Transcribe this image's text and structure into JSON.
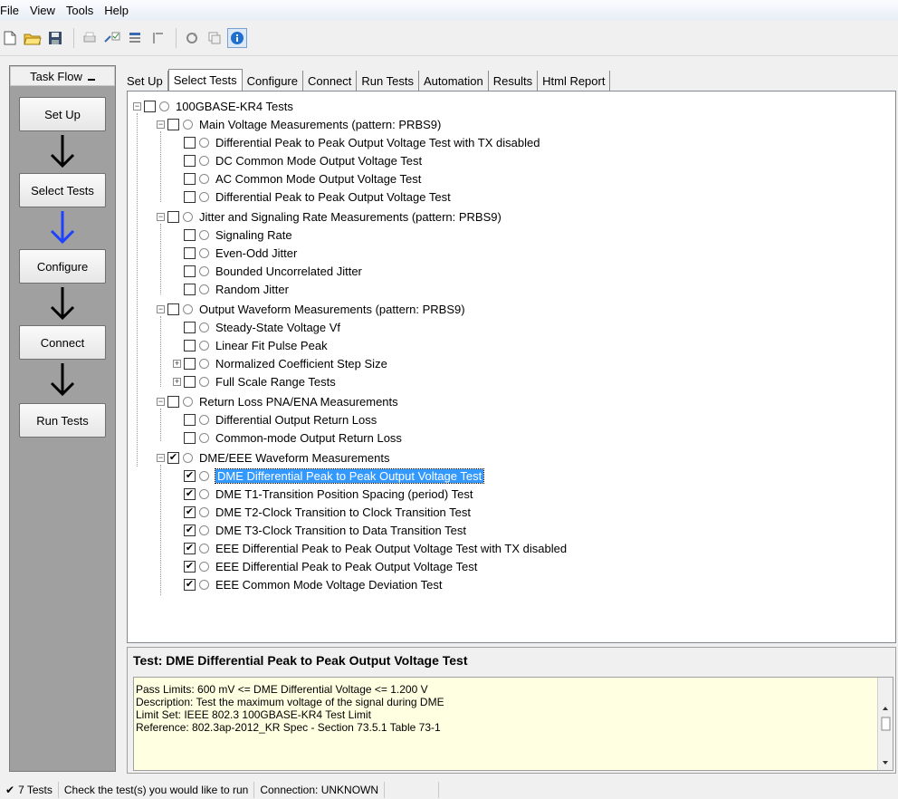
{
  "menu": [
    "File",
    "View",
    "Tools",
    "Help"
  ],
  "taskflow": {
    "title": "Task Flow",
    "steps": [
      "Set Up",
      "Select Tests",
      "Configure",
      "Connect",
      "Run Tests"
    ]
  },
  "tabs": [
    "Set Up",
    "Select Tests",
    "Configure",
    "Connect",
    "Run Tests",
    "Automation",
    "Results",
    "Html Report"
  ],
  "active_tab": "Select Tests",
  "tree": {
    "root": "100GBASE-KR4 Tests",
    "groups": [
      {
        "label": "Main Voltage Measurements (pattern: PRBS9)",
        "items": [
          "Differential Peak to Peak Output Voltage Test with TX disabled",
          "DC Common Mode Output Voltage Test",
          "AC Common Mode Output Voltage Test",
          "Differential Peak to Peak Output Voltage Test"
        ]
      },
      {
        "label": "Jitter and Signaling Rate Measurements (pattern: PRBS9)",
        "items": [
          "Signaling Rate",
          "Even-Odd Jitter",
          "Bounded Uncorrelated Jitter",
          "Random Jitter"
        ]
      },
      {
        "label": "Output Waveform Measurements (pattern: PRBS9)",
        "items": [
          "Steady-State Voltage Vf",
          "Linear Fit Pulse Peak",
          "Normalized Coefficient Step Size",
          "Full Scale Range Tests"
        ]
      },
      {
        "label": "Return Loss PNA/ENA Measurements",
        "items": [
          "Differential Output Return Loss",
          "Common-mode Output Return Loss"
        ]
      },
      {
        "label": "DME/EEE Waveform Measurements",
        "items": [
          "DME Differential Peak to Peak Output Voltage Test",
          "DME T1-Transition Position Spacing (period) Test",
          "DME T2-Clock Transition to Clock Transition Test",
          "DME T3-Clock Transition to Data Transition Test",
          "EEE Differential Peak to Peak Output Voltage Test with TX disabled",
          "EEE Differential Peak to Peak Output Voltage Test",
          "EEE Common Mode Voltage Deviation Test"
        ]
      }
    ]
  },
  "details": {
    "title": "Test: DME Differential Peak to Peak Output Voltage Test",
    "lines": [
      "Pass Limits: 600 mV <= DME Differential Voltage <= 1.200 V",
      "Description: Test the maximum voltage of the signal during DME",
      "Limit Set: IEEE 802.3 100GBASE-KR4 Test Limit",
      "Reference: 802.3ap-2012_KR Spec - Section 73.5.1 Table 73-1"
    ]
  },
  "status": {
    "count": "7 Tests",
    "hint": "Check the test(s) you would like to run",
    "connection": "Connection: UNKNOWN"
  }
}
